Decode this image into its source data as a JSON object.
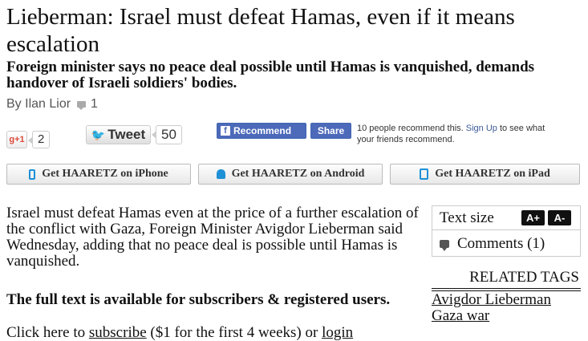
{
  "article": {
    "headline": "Lieberman: Israel must defeat Hamas, even if it means escalation",
    "subhead": "Foreign minister says no peace deal possible until Hamas is vanquished, demands handover of Israeli soldiers' bodies.",
    "byline": "By Ilan Lior",
    "comment_count": "1",
    "lede": "Israel must defeat Hamas even at the price of a further escalation of the conflict with Gaza, Foreign Minister Avigdor Lieberman said Wednesday, adding that no peace deal is possible until Hamas is vanquished."
  },
  "social": {
    "gplus_label": "g+1",
    "gplus_count": "2",
    "tweet_label": "Tweet",
    "tweet_count": "50",
    "fb_recommend_label": "Recommend",
    "fb_share_label": "Share",
    "fb_text_prefix": "10 people recommend this.",
    "fb_signup_link": "Sign Up",
    "fb_text_suffix": "to see what your friends recommend."
  },
  "apps": {
    "iphone_label": "Get HAARETZ on iPhone",
    "android_label": "Get HAARETZ on Android",
    "ipad_label": "Get HAARETZ on iPad"
  },
  "paywall": {
    "title": "The full text is available for subscribers & registered users.",
    "cta_prefix": "Click here to",
    "subscribe_link": "subscribe",
    "cta_middle": "($1 for the first 4 weeks) or",
    "login_link": "login"
  },
  "sidebar": {
    "text_size_label": "Text size",
    "increase_label": "A+",
    "decrease_label": "A-",
    "comments_label": "Comments (1)",
    "related_tags_title": "RELATED TAGS",
    "related_tags": [
      "Avigdor Lieberman",
      "Gaza war"
    ]
  },
  "icons": {
    "comment": "comment-bubble-icon",
    "twitter": "twitter-bird-icon",
    "facebook": "facebook-logo-icon",
    "iphone": "phone-icon",
    "android": "android-icon",
    "ipad": "tablet-icon",
    "comments": "speech-bubble-icon"
  },
  "colors": {
    "facebook_blue": "#4c69ba",
    "twitter_blue": "#2aa9e0",
    "gplus_red": "#dd4b39",
    "app_icon_blue": "#1e90d6"
  }
}
